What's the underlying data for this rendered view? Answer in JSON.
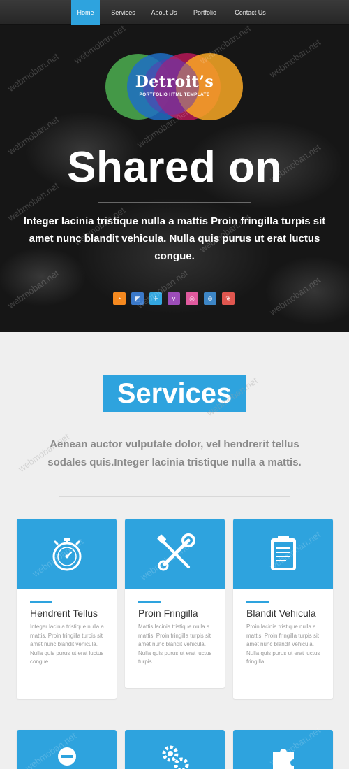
{
  "nav": {
    "items": [
      {
        "label": "Home",
        "active": true
      },
      {
        "label": "Services",
        "active": false
      },
      {
        "label": "About Us",
        "active": false
      },
      {
        "label": "Portfolio",
        "active": false
      },
      {
        "label": "Contact Us",
        "active": false
      }
    ]
  },
  "hero": {
    "logo_name": "Detroit’s",
    "logo_tagline": "PORTFOLIO HTML TEMPLATE",
    "title": "Shared on",
    "text": "Integer lacinia tristique nulla a mattis Proin fringilla turpis sit amet nunc blandit vehicula. Nulla quis purus ut erat luctus congue.",
    "social_icons": [
      "rss-icon",
      "delicious-icon",
      "twitter-icon",
      "vimeo-icon",
      "dribbble-icon",
      "globe-icon",
      "leaf-icon"
    ]
  },
  "services": {
    "heading": "Services",
    "lead": "Aenean auctor vulputate dolor, vel hendrerit tellus sodales quis.Integer lacinia tristique nulla a mattis.",
    "cards": [
      {
        "title": "Hendrerit Tellus",
        "icon": "stopwatch-icon",
        "text": "Integer lacinia tristique nulla a mattis. Proin fringilla turpis sit amet nunc blandit vehicula. Nulla quis purus ut erat luctus congue."
      },
      {
        "title": "Proin Fringilla",
        "icon": "tools-icon",
        "text": "Mattis lacinia tristique nulla a mattis. Proin fringilla turpis sit amet nunc blandit vehicula. Nulla quis purus ut erat luctus turpis."
      },
      {
        "title": "Blandit Vehicula",
        "icon": "clipboard-icon",
        "text": "Proin lacinia tristique nulla a mattis. Proin fringilla turpis sit amet nunc blandit vehicula. Nulla quis purus ut erat luctus fringilla."
      }
    ],
    "row2_icons": [
      "user-icon",
      "gears-icon",
      "puzzle-icon"
    ]
  },
  "watermark": "webmoban.net",
  "colors": {
    "accent": "#2ea3de",
    "nav_bg": "#2e2e2e",
    "hero_bg": "#161616"
  }
}
